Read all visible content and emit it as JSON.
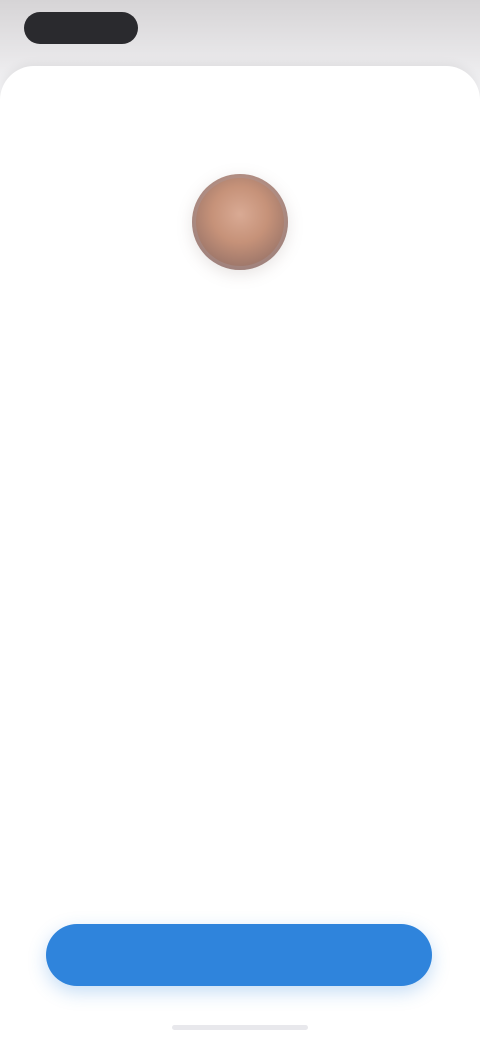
{
  "status_bar": {
    "time": ""
  },
  "profile": {
    "avatar_icon": "person-avatar-icon"
  },
  "content": {
    "title": "",
    "description": ""
  },
  "actions": {
    "primary_button_label": ""
  },
  "colors": {
    "accent": "#2f84dc",
    "background": "#ffffff",
    "title_text": "#1c1c1f",
    "body_text": "#8a8a90"
  }
}
